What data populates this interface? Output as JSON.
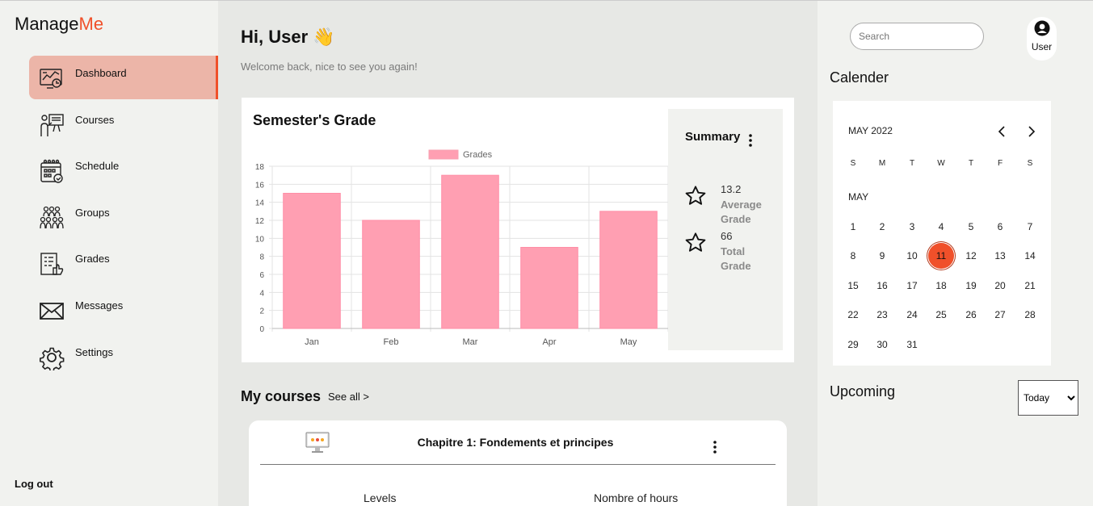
{
  "app": {
    "logo_part1": "Manage",
    "logo_part2": "Me"
  },
  "sidebar": {
    "items": [
      {
        "label": "Dashboard",
        "icon": "dashboard-icon",
        "active": true
      },
      {
        "label": "Courses",
        "icon": "courses-icon",
        "active": false
      },
      {
        "label": "Schedule",
        "icon": "schedule-icon",
        "active": false
      },
      {
        "label": "Groups",
        "icon": "groups-icon",
        "active": false
      },
      {
        "label": "Grades",
        "icon": "grades-icon",
        "active": false
      },
      {
        "label": "Messages",
        "icon": "messages-icon",
        "active": false
      },
      {
        "label": "Settings",
        "icon": "settings-icon",
        "active": false
      }
    ],
    "logout_label": "Log out"
  },
  "header": {
    "greeting": "Hi, User",
    "greeting_emoji": "👋",
    "subtitle": "Welcome back, nice to see you again!"
  },
  "grades": {
    "title": "Semester's Grade",
    "summary": {
      "title": "Summary",
      "stats": [
        {
          "value": "13.2",
          "label": "Average Grade"
        },
        {
          "value": "66",
          "label": "Total Grade"
        }
      ]
    }
  },
  "chart_data": {
    "type": "bar",
    "title": "",
    "categories": [
      "Jan",
      "Feb",
      "Mar",
      "Apr",
      "May"
    ],
    "series": [
      {
        "name": "Grades",
        "values": [
          15,
          12,
          17,
          9,
          13
        ]
      }
    ],
    "ylim": [
      0,
      18
    ],
    "yticks": [
      0,
      2,
      4,
      6,
      8,
      10,
      12,
      14,
      16,
      18
    ],
    "grid": true,
    "legend": "top",
    "color": "#ff9fb2"
  },
  "courses": {
    "title": "My courses",
    "see_all": "See all >",
    "card": {
      "title": "Chapitre 1: Fondements et principes",
      "icon": "monitor-icon",
      "col1": "Levels",
      "col2": "Nombre of hours"
    }
  },
  "right": {
    "search_placeholder": "Search",
    "user_label": "User",
    "calendar_title": "Calender",
    "calendar": {
      "month_label": "MAY 2022",
      "sub_label": "MAY",
      "weekdays": [
        "S",
        "M",
        "T",
        "W",
        "T",
        "F",
        "S"
      ],
      "days": [
        "1",
        "2",
        "3",
        "4",
        "5",
        "6",
        "7",
        "8",
        "9",
        "10",
        "11",
        "12",
        "13",
        "14",
        "15",
        "16",
        "17",
        "18",
        "19",
        "20",
        "21",
        "22",
        "23",
        "24",
        "25",
        "26",
        "27",
        "28",
        "29",
        "30",
        "31"
      ],
      "today": 11
    },
    "upcoming_title": "Upcoming",
    "upcoming_filter": "Today"
  },
  "colors": {
    "accent": "#f0502a",
    "active_bg": "#ecb5a8",
    "bar": "#ff9fb2"
  }
}
